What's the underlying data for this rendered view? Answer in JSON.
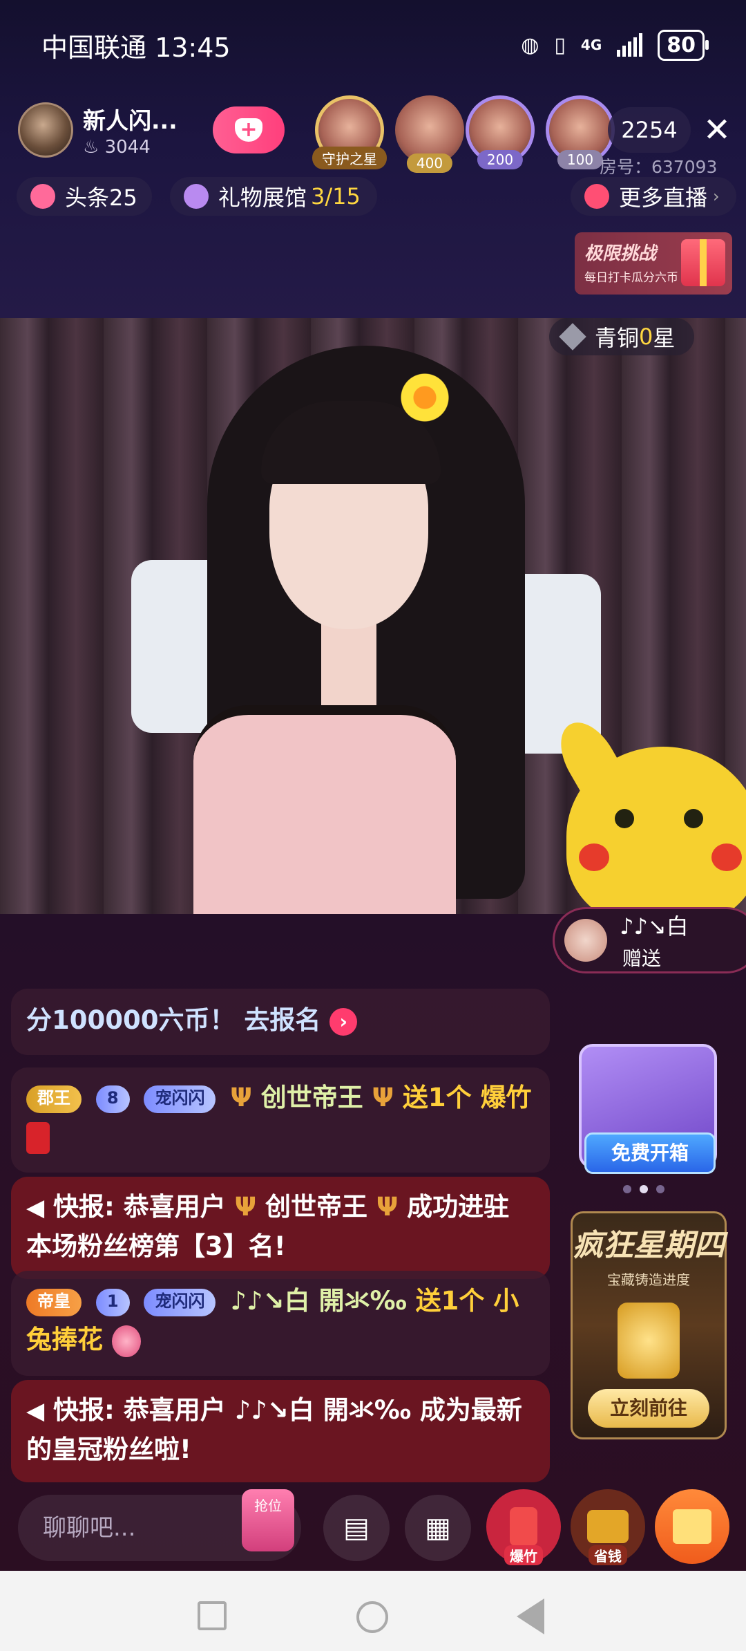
{
  "status_bar": {
    "carrier_time": "中国联通 13:45",
    "network": "4G",
    "battery": "80"
  },
  "host": {
    "name": "新人闪...",
    "fans": "3044"
  },
  "viewers": [
    {
      "badge": "守护之星"
    },
    {
      "badge": "400"
    },
    {
      "badge": "200"
    },
    {
      "badge": "100"
    }
  ],
  "online_count": "2254",
  "room_number": "房号：637093",
  "headline": {
    "label": "头条25"
  },
  "gift_hall": {
    "label": "礼物展馆",
    "progress": "3/15"
  },
  "more_live": {
    "label": "更多直播"
  },
  "challenge_banner": {
    "title": "极限挑战",
    "subtitle": "每日打卡瓜分六币"
  },
  "rank_badge": {
    "prefix": "青铜",
    "num": "0",
    "suffix": "星"
  },
  "gift_notice": {
    "user": "♪♪↘白",
    "action": "赠送"
  },
  "messages": {
    "m0": {
      "text": "分100000六币！",
      "link": "去报名"
    },
    "m1": {
      "badge1": "郡王",
      "badge2_num": "8",
      "badge2": "宠闪闪",
      "user": "创世帝王",
      "action": "送1个",
      "gift": "爆竹"
    },
    "m2": {
      "prefix": "快报: 恭喜用户",
      "user": "创世帝王",
      "text": "成功进驻本场粉丝榜第【3】名!"
    },
    "m3": {
      "badge1": "帝皇",
      "badge2_num": "1",
      "badge2": "宠闪闪",
      "user": "♪♪↘白   開氺‰",
      "action": "送1个",
      "gift": "小兔捧花"
    },
    "m4": {
      "prefix": "快报: 恭喜用户",
      "user": "♪♪↘白   開氺‰",
      "text": "成为最新的皇冠粉丝啦!"
    }
  },
  "treasure": {
    "button": "免费开箱"
  },
  "thursday": {
    "title": "疯狂星期四",
    "subtitle": "宝藏铸造进度",
    "button": "立刻前往"
  },
  "bottom": {
    "chat_placeholder": "聊聊吧...",
    "grab_label": "抢位",
    "firecracker_label": "爆竹",
    "savings_label": "省钱"
  }
}
